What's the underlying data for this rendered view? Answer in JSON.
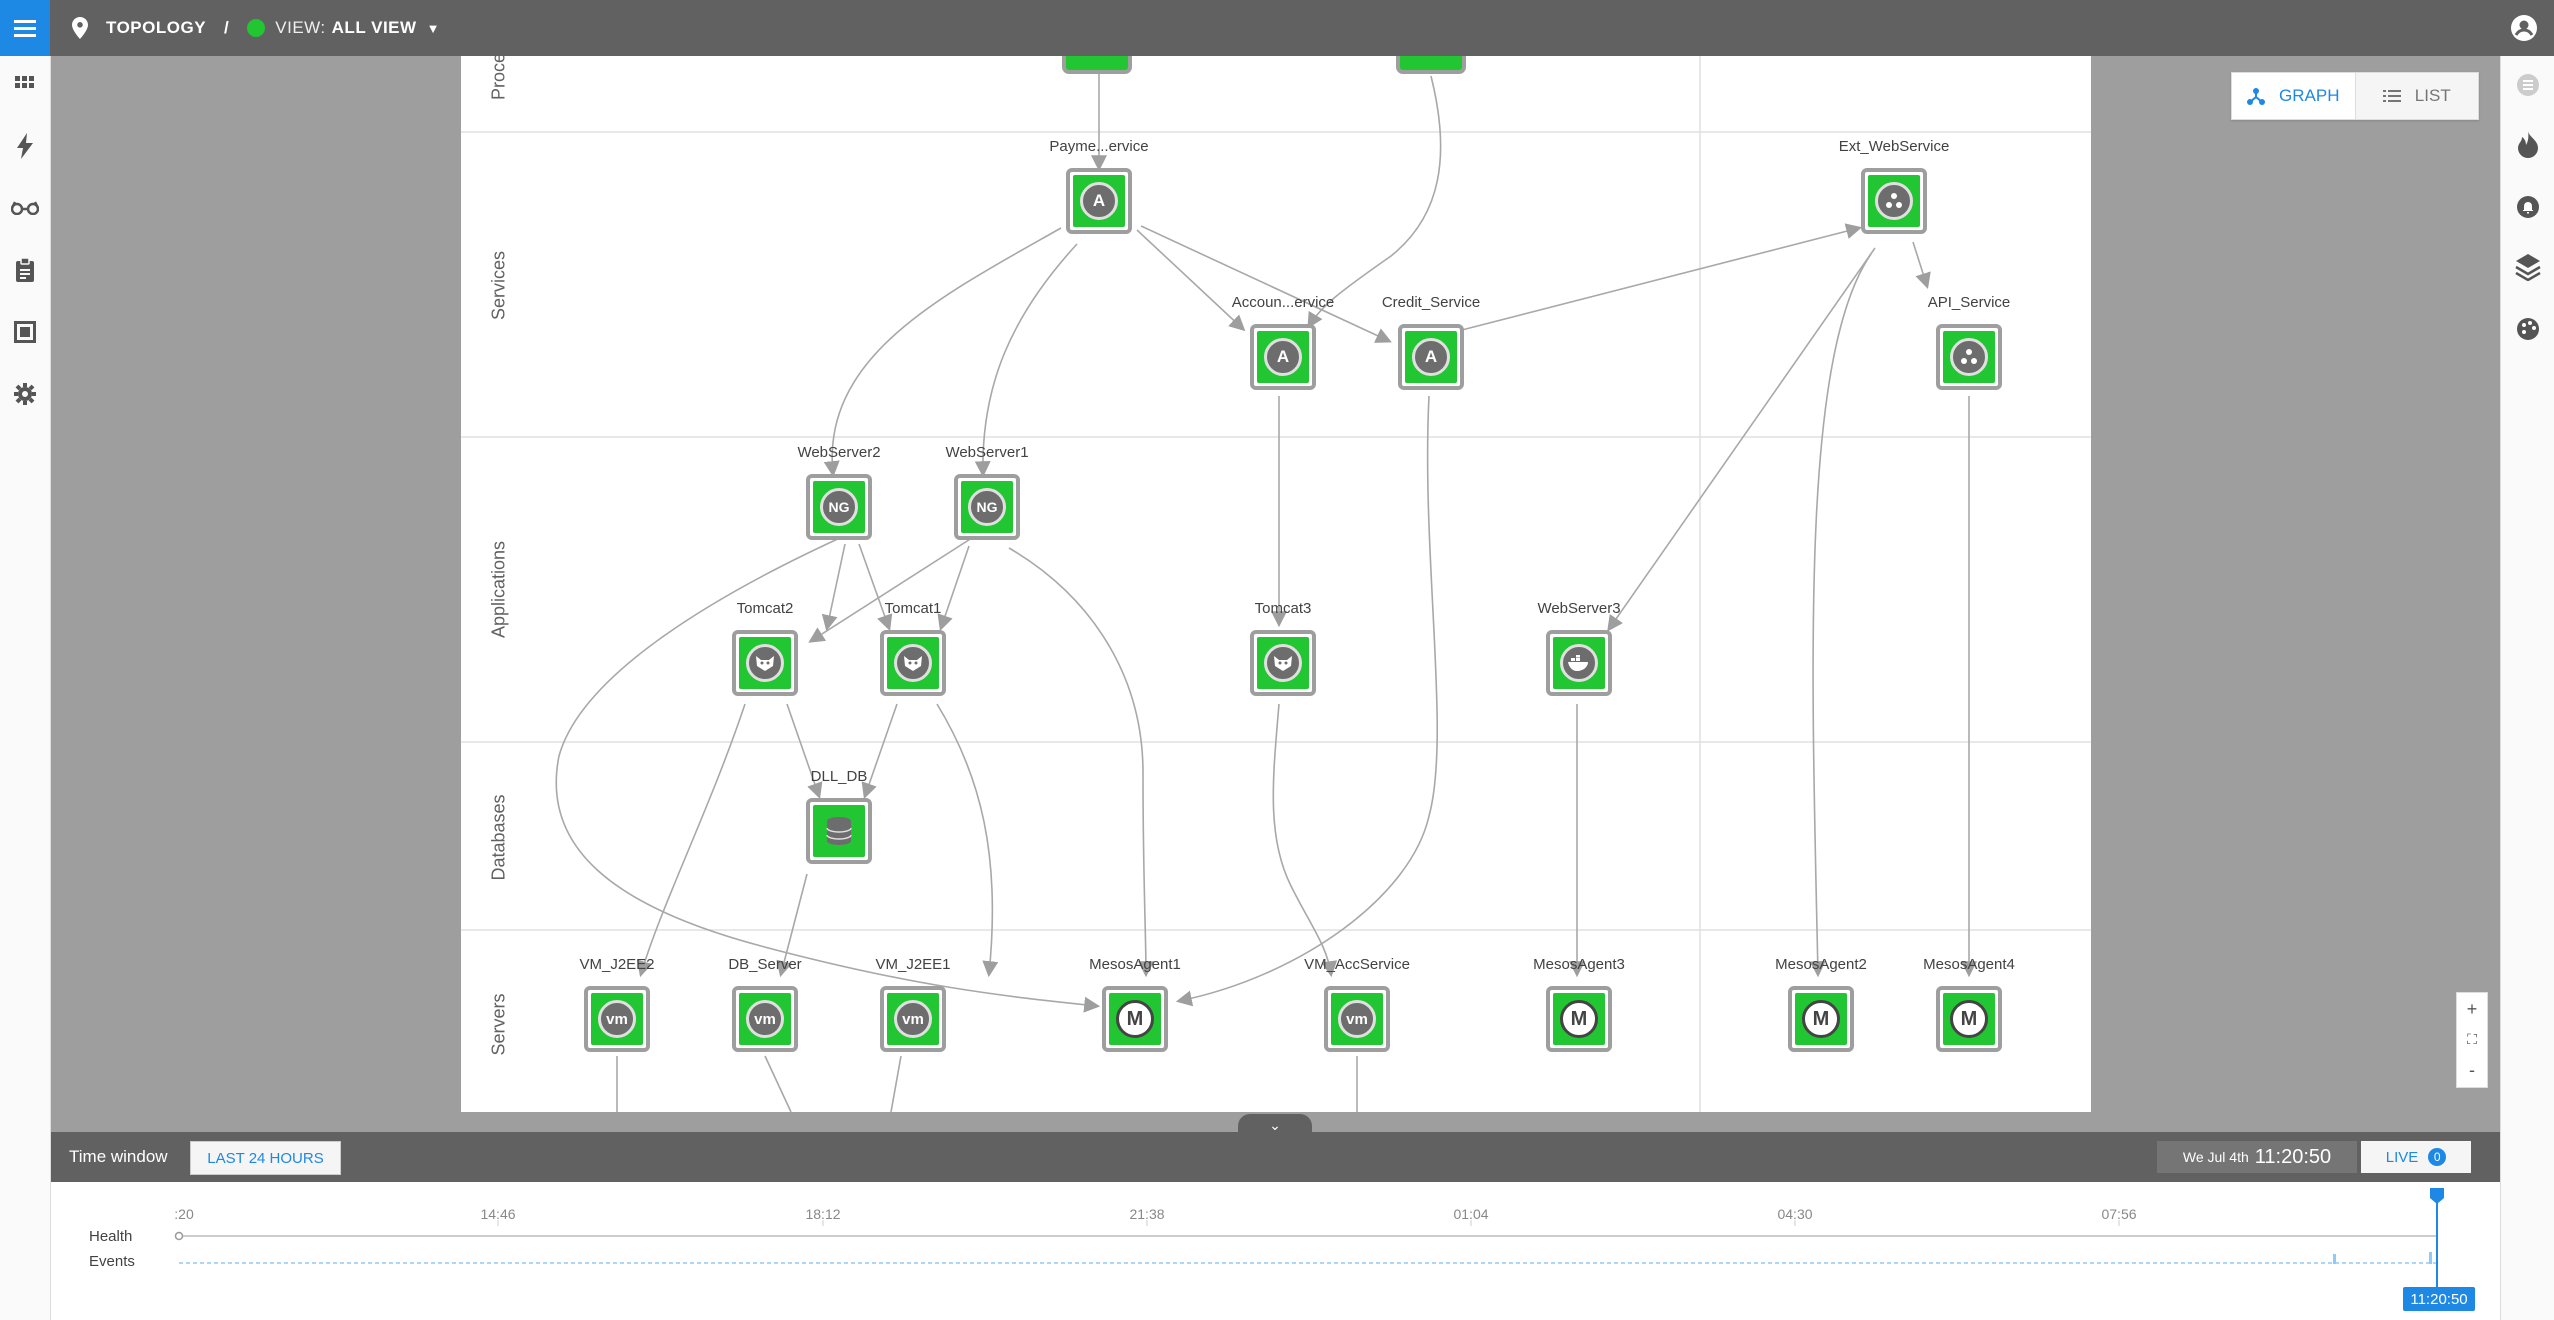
{
  "header": {
    "section": "TOPOLOGY",
    "separator": "/",
    "view_prefix": "VIEW:",
    "view_name": "ALL VIEW"
  },
  "left_nav": [
    "dashboard-icon",
    "lightning-icon",
    "glasses-icon",
    "clipboard-icon",
    "panel-icon",
    "gear-icon"
  ],
  "right_nav": [
    "list-icon",
    "flame-icon",
    "bell-icon",
    "layers-icon",
    "palette-icon"
  ],
  "view_toggle": {
    "graph_label": "GRAPH",
    "list_label": "LIST",
    "active": "GRAPH"
  },
  "layers": [
    "Proce",
    "Services",
    "Applications",
    "Databases",
    "Servers"
  ],
  "nodes": {
    "payment_service": {
      "label": "Payme...ervice",
      "icon": "A"
    },
    "account_service": {
      "label": "Accoun...ervice",
      "icon": "A"
    },
    "credit_service": {
      "label": "Credit_Service",
      "icon": "A"
    },
    "ext_webservice": {
      "label": "Ext_WebService",
      "icon": "network-icon"
    },
    "api_service": {
      "label": "API_Service",
      "icon": "network-icon"
    },
    "webserver2": {
      "label": "WebServer2",
      "icon": "NG"
    },
    "webserver1": {
      "label": "WebServer1",
      "icon": "NG"
    },
    "tomcat2": {
      "label": "Tomcat2",
      "icon": "tomcat-icon"
    },
    "tomcat1": {
      "label": "Tomcat1",
      "icon": "tomcat-icon"
    },
    "tomcat3": {
      "label": "Tomcat3",
      "icon": "tomcat-icon"
    },
    "webserver3": {
      "label": "WebServer3",
      "icon": "docker-icon"
    },
    "dll_db": {
      "label": "DLL_DB",
      "icon": "database-icon"
    },
    "vm_j2ee2": {
      "label": "VM_J2EE2",
      "icon": "vm"
    },
    "db_server": {
      "label": "DB_Server",
      "icon": "vm"
    },
    "vm_j2ee1": {
      "label": "VM_J2EE1",
      "icon": "vm"
    },
    "mesosagent1": {
      "label": "MesosAgent1",
      "icon": "M"
    },
    "vm_accservice": {
      "label": "VM_AccService",
      "icon": "vm"
    },
    "mesosagent3": {
      "label": "MesosAgent3",
      "icon": "M"
    },
    "mesosagent2": {
      "label": "MesosAgent2",
      "icon": "M"
    },
    "mesosagent4": {
      "label": "MesosAgent4",
      "icon": "M"
    }
  },
  "colors": {
    "accent": "#1e88e5",
    "node_ok": "#22c532",
    "topbar": "#616161"
  },
  "time_window": {
    "label": "Time window",
    "range_button": "LAST 24 HOURS",
    "date": "We Jul 4th",
    "time": "11:20:50",
    "live_label": "LIVE",
    "live_count": "0"
  },
  "timeline": {
    "ticks": [
      ":20",
      "14:46",
      "18:12",
      "21:38",
      "01:04",
      "04:30",
      "07:56"
    ],
    "health_label": "Health",
    "events_label": "Events",
    "cursor_time": "11:20:50"
  },
  "zoom": {
    "in": "+",
    "fit": "⛶",
    "out": "-"
  },
  "collapse": "⌄"
}
